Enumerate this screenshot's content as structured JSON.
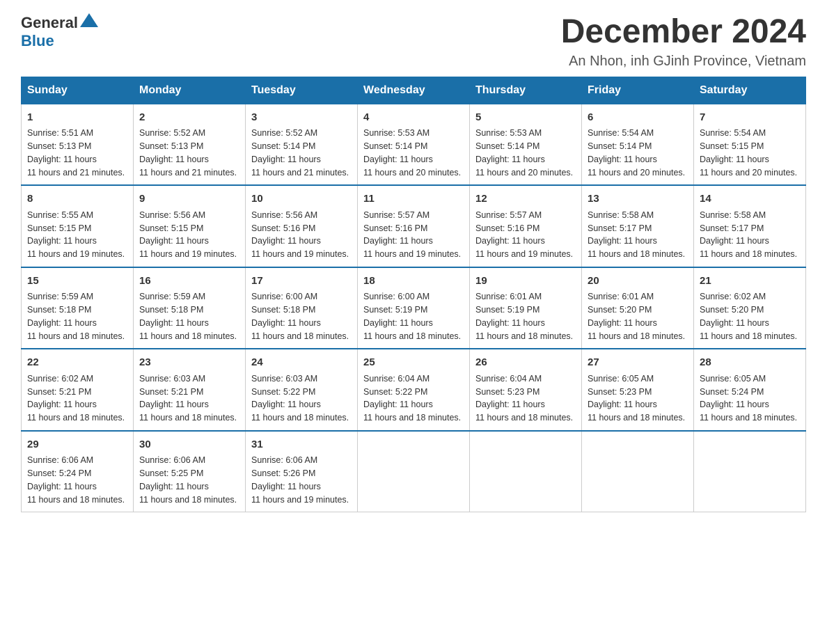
{
  "logo": {
    "text_general": "General",
    "text_blue": "Blue"
  },
  "title": "December 2024",
  "location": "An Nhon, inh GJinh Province, Vietnam",
  "days_of_week": [
    "Sunday",
    "Monday",
    "Tuesday",
    "Wednesday",
    "Thursday",
    "Friday",
    "Saturday"
  ],
  "weeks": [
    [
      {
        "day": "1",
        "sunrise": "5:51 AM",
        "sunset": "5:13 PM",
        "daylight": "11 hours and 21 minutes."
      },
      {
        "day": "2",
        "sunrise": "5:52 AM",
        "sunset": "5:13 PM",
        "daylight": "11 hours and 21 minutes."
      },
      {
        "day": "3",
        "sunrise": "5:52 AM",
        "sunset": "5:14 PM",
        "daylight": "11 hours and 21 minutes."
      },
      {
        "day": "4",
        "sunrise": "5:53 AM",
        "sunset": "5:14 PM",
        "daylight": "11 hours and 20 minutes."
      },
      {
        "day": "5",
        "sunrise": "5:53 AM",
        "sunset": "5:14 PM",
        "daylight": "11 hours and 20 minutes."
      },
      {
        "day": "6",
        "sunrise": "5:54 AM",
        "sunset": "5:14 PM",
        "daylight": "11 hours and 20 minutes."
      },
      {
        "day": "7",
        "sunrise": "5:54 AM",
        "sunset": "5:15 PM",
        "daylight": "11 hours and 20 minutes."
      }
    ],
    [
      {
        "day": "8",
        "sunrise": "5:55 AM",
        "sunset": "5:15 PM",
        "daylight": "11 hours and 19 minutes."
      },
      {
        "day": "9",
        "sunrise": "5:56 AM",
        "sunset": "5:15 PM",
        "daylight": "11 hours and 19 minutes."
      },
      {
        "day": "10",
        "sunrise": "5:56 AM",
        "sunset": "5:16 PM",
        "daylight": "11 hours and 19 minutes."
      },
      {
        "day": "11",
        "sunrise": "5:57 AM",
        "sunset": "5:16 PM",
        "daylight": "11 hours and 19 minutes."
      },
      {
        "day": "12",
        "sunrise": "5:57 AM",
        "sunset": "5:16 PM",
        "daylight": "11 hours and 19 minutes."
      },
      {
        "day": "13",
        "sunrise": "5:58 AM",
        "sunset": "5:17 PM",
        "daylight": "11 hours and 18 minutes."
      },
      {
        "day": "14",
        "sunrise": "5:58 AM",
        "sunset": "5:17 PM",
        "daylight": "11 hours and 18 minutes."
      }
    ],
    [
      {
        "day": "15",
        "sunrise": "5:59 AM",
        "sunset": "5:18 PM",
        "daylight": "11 hours and 18 minutes."
      },
      {
        "day": "16",
        "sunrise": "5:59 AM",
        "sunset": "5:18 PM",
        "daylight": "11 hours and 18 minutes."
      },
      {
        "day": "17",
        "sunrise": "6:00 AM",
        "sunset": "5:18 PM",
        "daylight": "11 hours and 18 minutes."
      },
      {
        "day": "18",
        "sunrise": "6:00 AM",
        "sunset": "5:19 PM",
        "daylight": "11 hours and 18 minutes."
      },
      {
        "day": "19",
        "sunrise": "6:01 AM",
        "sunset": "5:19 PM",
        "daylight": "11 hours and 18 minutes."
      },
      {
        "day": "20",
        "sunrise": "6:01 AM",
        "sunset": "5:20 PM",
        "daylight": "11 hours and 18 minutes."
      },
      {
        "day": "21",
        "sunrise": "6:02 AM",
        "sunset": "5:20 PM",
        "daylight": "11 hours and 18 minutes."
      }
    ],
    [
      {
        "day": "22",
        "sunrise": "6:02 AM",
        "sunset": "5:21 PM",
        "daylight": "11 hours and 18 minutes."
      },
      {
        "day": "23",
        "sunrise": "6:03 AM",
        "sunset": "5:21 PM",
        "daylight": "11 hours and 18 minutes."
      },
      {
        "day": "24",
        "sunrise": "6:03 AM",
        "sunset": "5:22 PM",
        "daylight": "11 hours and 18 minutes."
      },
      {
        "day": "25",
        "sunrise": "6:04 AM",
        "sunset": "5:22 PM",
        "daylight": "11 hours and 18 minutes."
      },
      {
        "day": "26",
        "sunrise": "6:04 AM",
        "sunset": "5:23 PM",
        "daylight": "11 hours and 18 minutes."
      },
      {
        "day": "27",
        "sunrise": "6:05 AM",
        "sunset": "5:23 PM",
        "daylight": "11 hours and 18 minutes."
      },
      {
        "day": "28",
        "sunrise": "6:05 AM",
        "sunset": "5:24 PM",
        "daylight": "11 hours and 18 minutes."
      }
    ],
    [
      {
        "day": "29",
        "sunrise": "6:06 AM",
        "sunset": "5:24 PM",
        "daylight": "11 hours and 18 minutes."
      },
      {
        "day": "30",
        "sunrise": "6:06 AM",
        "sunset": "5:25 PM",
        "daylight": "11 hours and 18 minutes."
      },
      {
        "day": "31",
        "sunrise": "6:06 AM",
        "sunset": "5:26 PM",
        "daylight": "11 hours and 19 minutes."
      },
      null,
      null,
      null,
      null
    ]
  ],
  "sunrise_label": "Sunrise:",
  "sunset_label": "Sunset:",
  "daylight_label": "Daylight:"
}
